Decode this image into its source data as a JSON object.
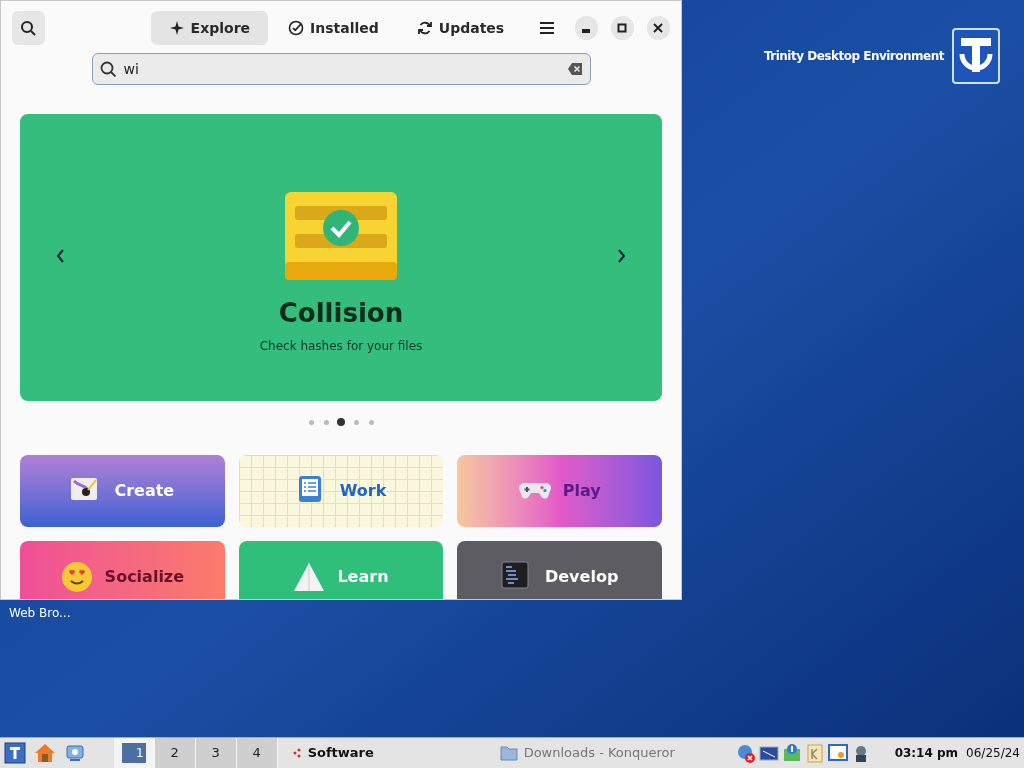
{
  "window": {
    "tabs": [
      {
        "label": "Explore",
        "kind": "sparkle",
        "selected": true
      },
      {
        "label": "Installed",
        "kind": "check",
        "selected": false
      },
      {
        "label": "Updates",
        "kind": "refresh",
        "selected": false
      }
    ],
    "search": {
      "value": "wi"
    },
    "banner": {
      "title": "Collision",
      "subtitle": "Check hashes for your files",
      "dots": [
        {
          "selected": false
        },
        {
          "selected": false
        },
        {
          "selected": true
        },
        {
          "selected": false
        },
        {
          "selected": false
        }
      ]
    },
    "categories": [
      {
        "label": "Create",
        "kind": "create"
      },
      {
        "label": "Work",
        "kind": "work"
      },
      {
        "label": "Play",
        "kind": "play"
      },
      {
        "label": "Socialize",
        "kind": "socialize"
      },
      {
        "label": "Learn",
        "kind": "learn"
      },
      {
        "label": "Develop",
        "kind": "develop"
      }
    ]
  },
  "desktop": {
    "logo_text": "Trinity Desktop Environment",
    "icon_label": "Web Bro..."
  },
  "taskbar": {
    "desktops": [
      {
        "label": "1",
        "selected": true
      },
      {
        "label": "2",
        "selected": false
      },
      {
        "label": "3",
        "selected": false
      },
      {
        "label": "4",
        "selected": false
      }
    ],
    "tasks": [
      {
        "label": "Software",
        "selected": true
      },
      {
        "label": "Downloads - Konqueror",
        "selected": false
      }
    ],
    "time": "03:14 pm",
    "date": "06/25/24"
  }
}
